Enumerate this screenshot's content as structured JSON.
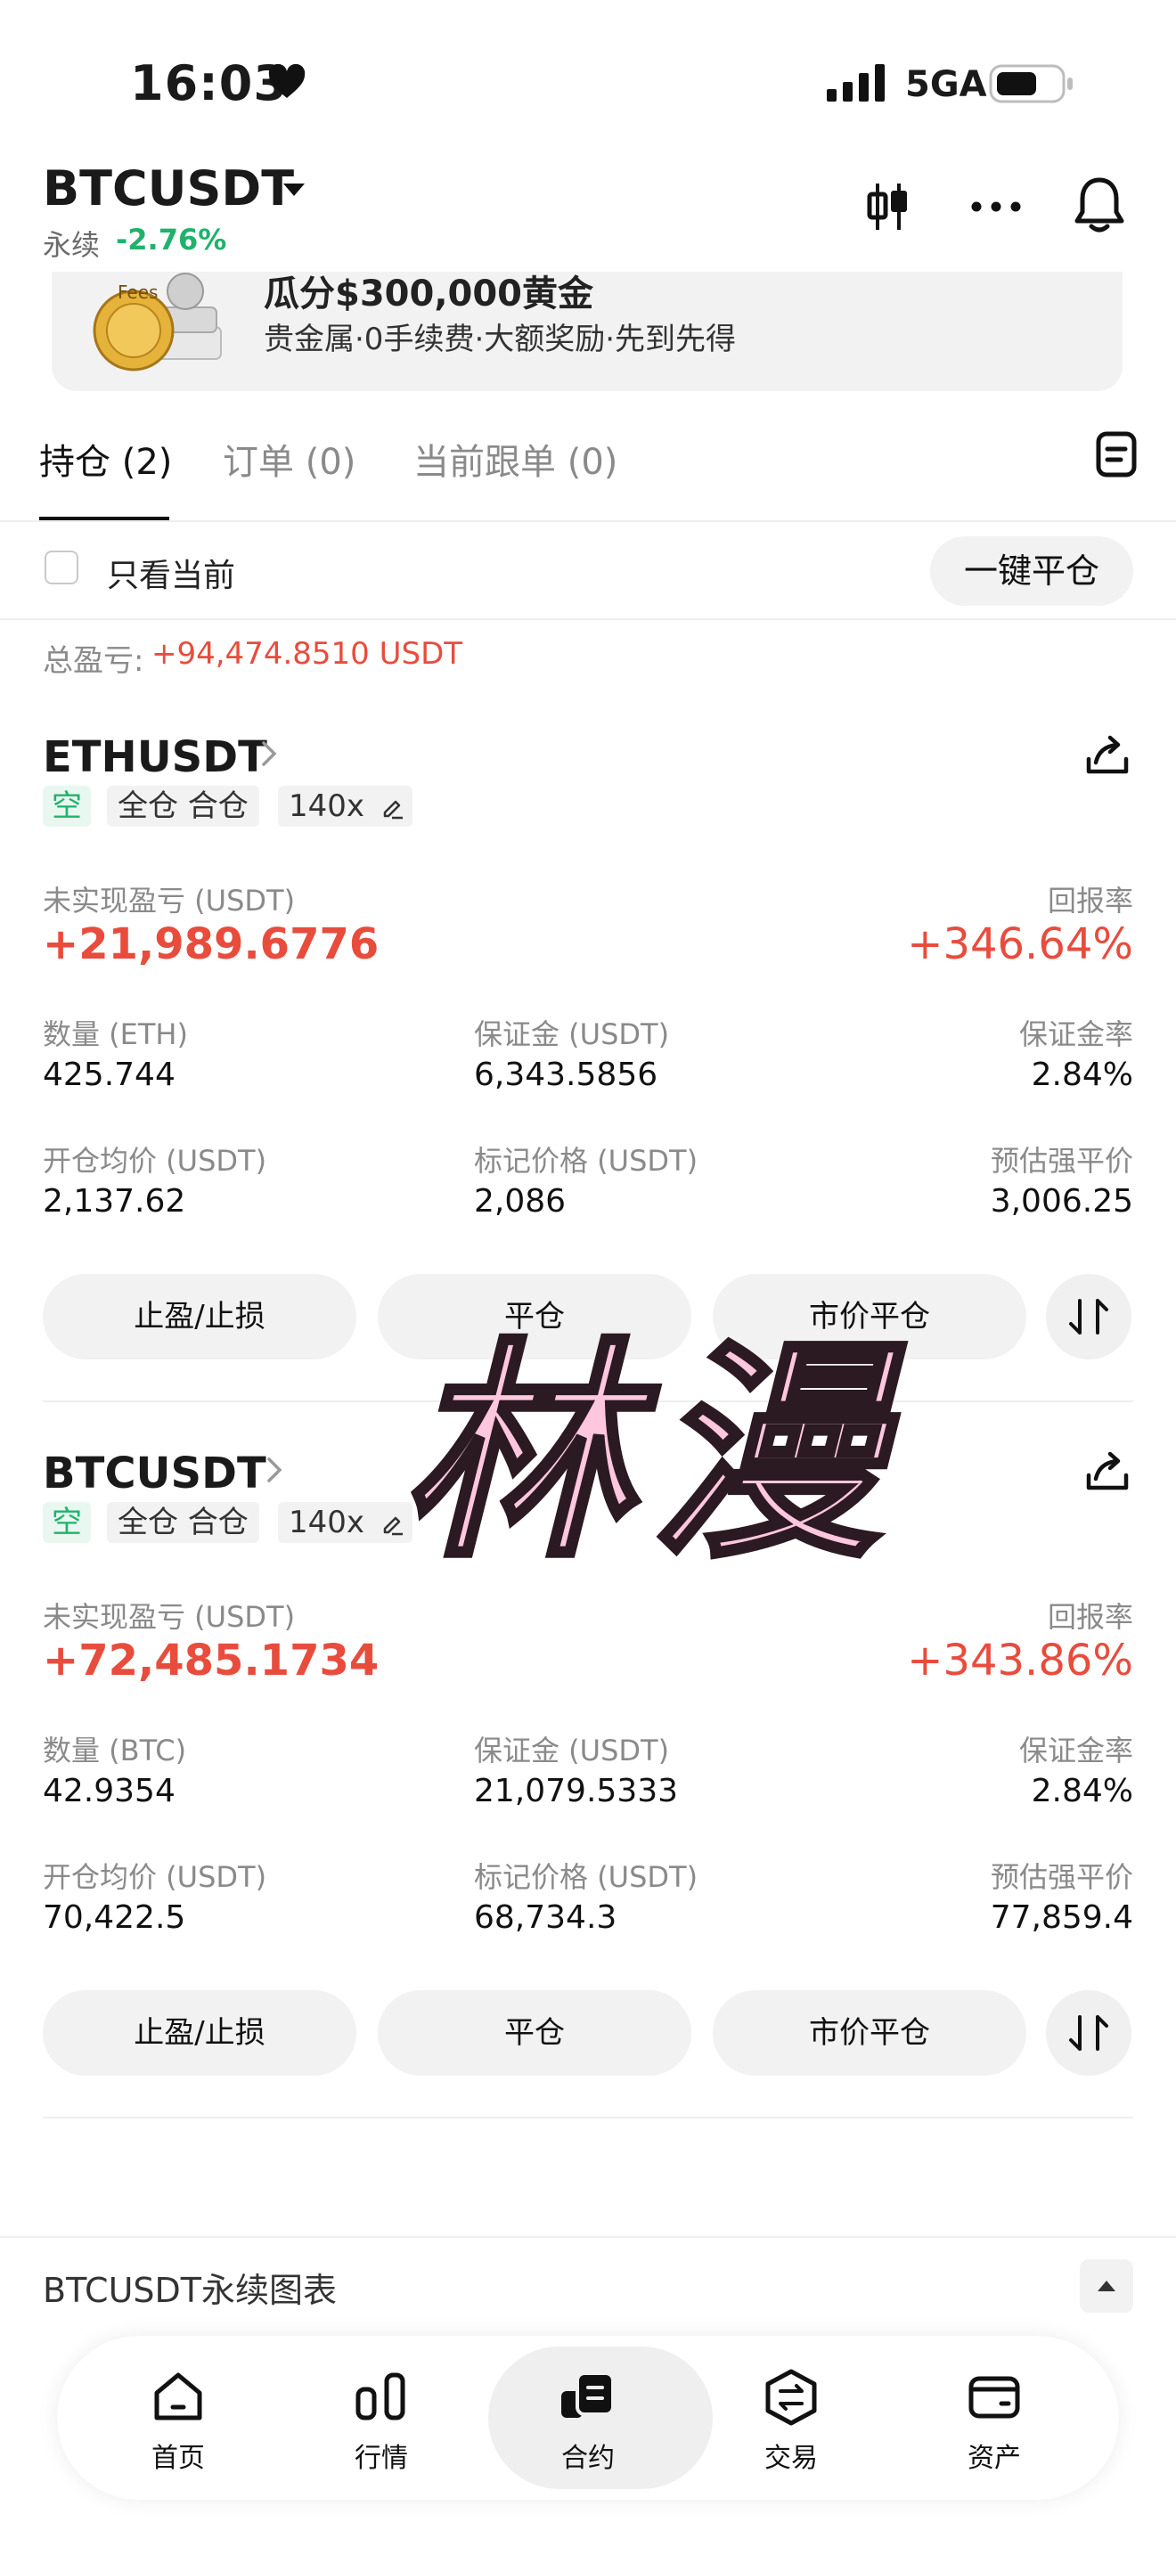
{
  "status_bar": {
    "time": "16:03",
    "network": "5GA"
  },
  "header": {
    "symbol": "BTCUSDT",
    "contract_type": "永续",
    "change": "-2.76%"
  },
  "banner": {
    "title": "瓜分$300,000黄金",
    "subtitle": "贵金属·0手续费·大额奖励·先到先得"
  },
  "tabs": [
    {
      "label": "持仓 (2)"
    },
    {
      "label": "订单 (0)"
    },
    {
      "label": "当前跟单 (0)"
    }
  ],
  "filter": {
    "only_current_label": "只看当前",
    "close_all_label": "一键平仓"
  },
  "total_pnl": {
    "label": "总盈亏:",
    "value": "+94,474.8510 USDT"
  },
  "positions": [
    {
      "symbol": "ETHUSDT",
      "side": "空",
      "margin_mode": "全仓 合仓",
      "leverage": "140x",
      "unrealized_pnl_label": "未实现盈亏 (USDT)",
      "unrealized_pnl": "+21,989.6776",
      "roe_label": "回报率",
      "roe": "+346.64%",
      "qty_label": "数量 (ETH)",
      "qty": "425.744",
      "margin_label": "保证金 (USDT)",
      "margin": "6,343.5856",
      "margin_ratio_label": "保证金率",
      "margin_ratio": "2.84%",
      "entry_label": "开仓均价 (USDT)",
      "entry": "2,137.62",
      "mark_label": "标记价格 (USDT)",
      "mark": "2,086",
      "liq_label": "预估强平价",
      "liq": "3,006.25",
      "btn_tpsl": "止盈/止损",
      "btn_close": "平仓",
      "btn_market_close": "市价平仓"
    },
    {
      "symbol": "BTCUSDT",
      "side": "空",
      "margin_mode": "全仓 合仓",
      "leverage": "140x",
      "unrealized_pnl_label": "未实现盈亏 (USDT)",
      "unrealized_pnl": "+72,485.1734",
      "roe_label": "回报率",
      "roe": "+343.86%",
      "qty_label": "数量 (BTC)",
      "qty": "42.9354",
      "margin_label": "保证金 (USDT)",
      "margin": "21,079.5333",
      "margin_ratio_label": "保证金率",
      "margin_ratio": "2.84%",
      "entry_label": "开仓均价 (USDT)",
      "entry": "70,422.5",
      "mark_label": "标记价格 (USDT)",
      "mark": "68,734.3",
      "liq_label": "预估强平价",
      "liq": "77,859.4",
      "btn_tpsl": "止盈/止损",
      "btn_close": "平仓",
      "btn_market_close": "市价平仓"
    }
  ],
  "watermark": "林漫",
  "chart_strip": {
    "label": "BTCUSDT永续图表"
  },
  "bottom_nav": [
    {
      "label": "首页",
      "icon": "home-icon"
    },
    {
      "label": "行情",
      "icon": "market-bars-icon"
    },
    {
      "label": "合约",
      "icon": "contract-icon",
      "active": true
    },
    {
      "label": "交易",
      "icon": "trade-icon"
    },
    {
      "label": "资产",
      "icon": "wallet-icon"
    }
  ],
  "colors": {
    "up": "#20b26c",
    "down_pnl": "#e84c3d",
    "text": "#111111",
    "muted": "#8a8a8a"
  }
}
